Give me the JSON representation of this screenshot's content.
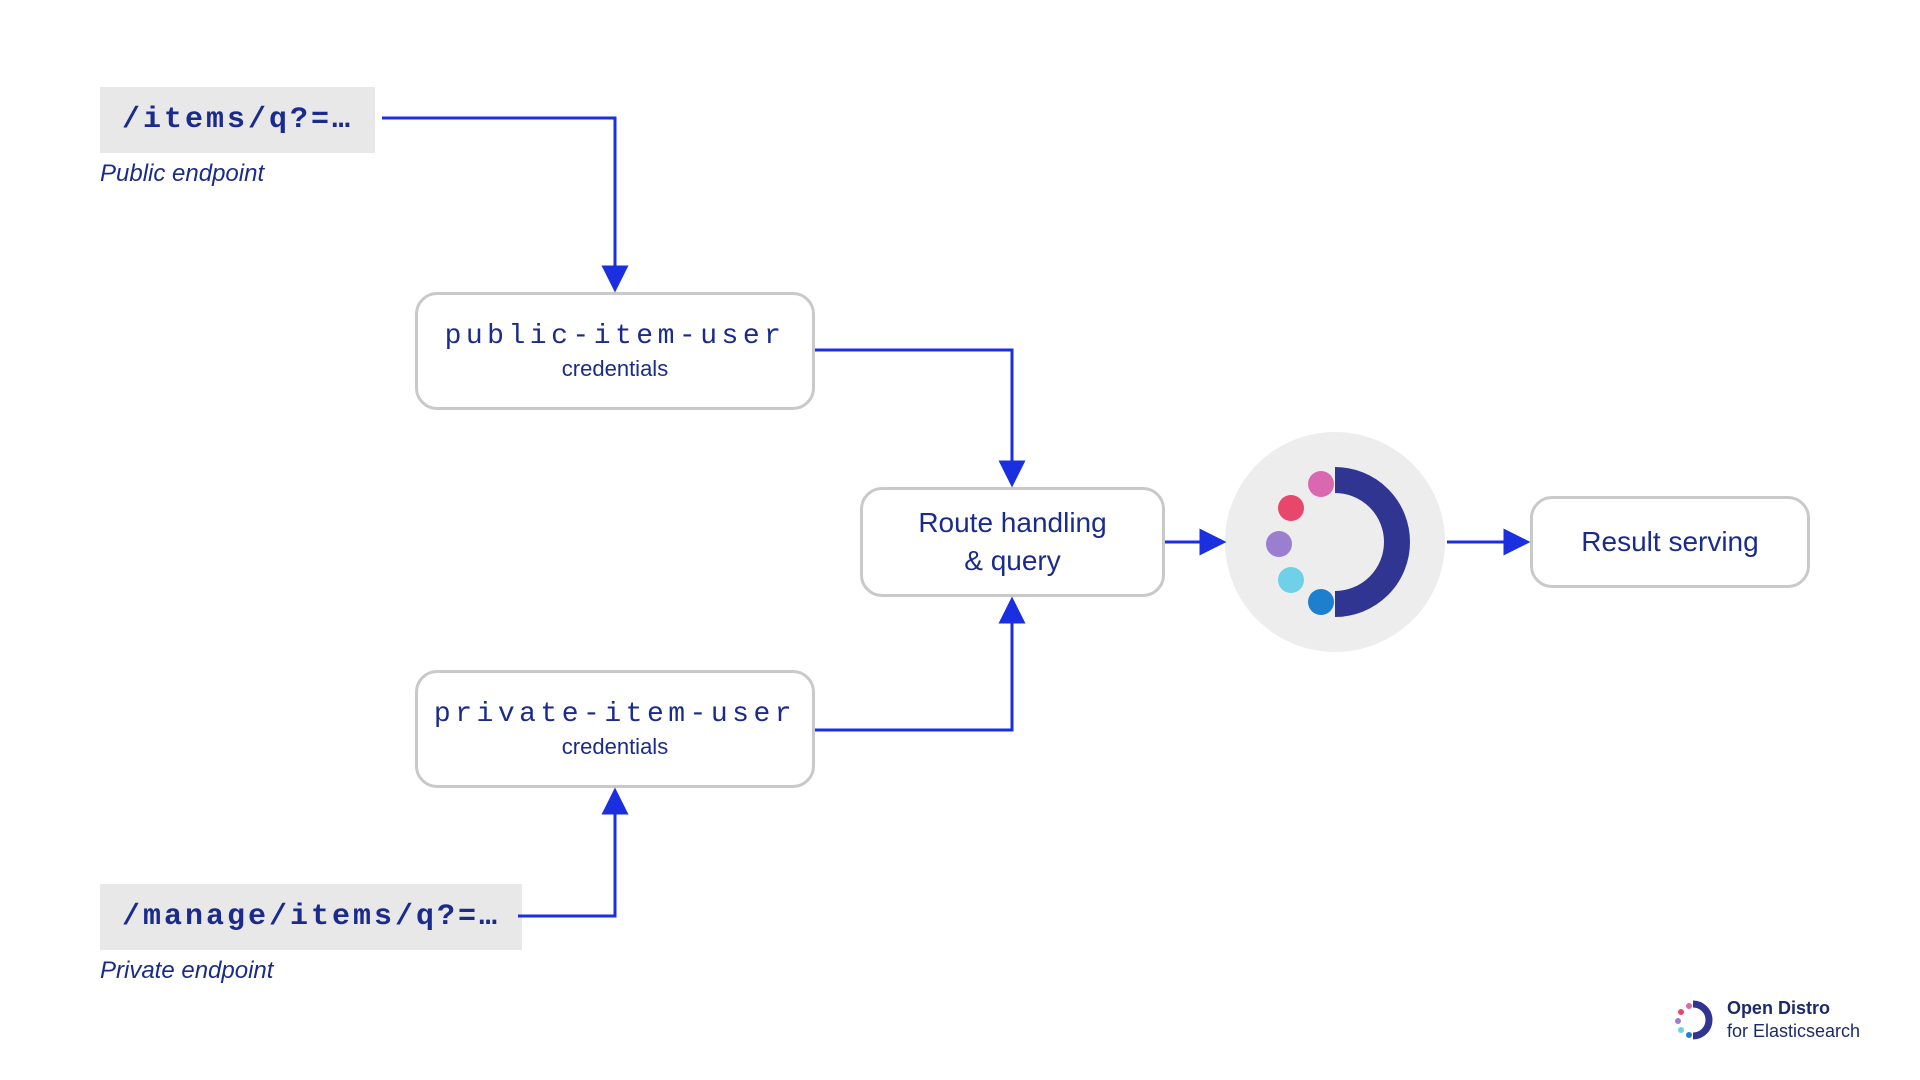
{
  "endpoints": {
    "public": {
      "path": "/items/q?=…",
      "label": "Public endpoint"
    },
    "private": {
      "path": "/manage/items/q?=…",
      "label": "Private endpoint"
    }
  },
  "credentials": {
    "public": {
      "user": "public-item-user",
      "sub": "credentials"
    },
    "private": {
      "user": "private-item-user",
      "sub": "credentials"
    }
  },
  "route": {
    "line1": "Route handling",
    "line2": "& query"
  },
  "result": {
    "label": "Result serving"
  },
  "footer": {
    "bold": "Open Distro",
    "sub": "for Elasticsearch"
  },
  "colors": {
    "edge": "#1a2fe0",
    "text": "#1a2b8c",
    "box_border": "#c9c9c9",
    "endpoint_bg": "#e8e8e8",
    "logo_bg": "#ededed",
    "arc": "#2f3590",
    "dots": [
      "#d968b1",
      "#e7476a",
      "#9a7fd1",
      "#6fd0e8",
      "#1f7fcf"
    ]
  }
}
